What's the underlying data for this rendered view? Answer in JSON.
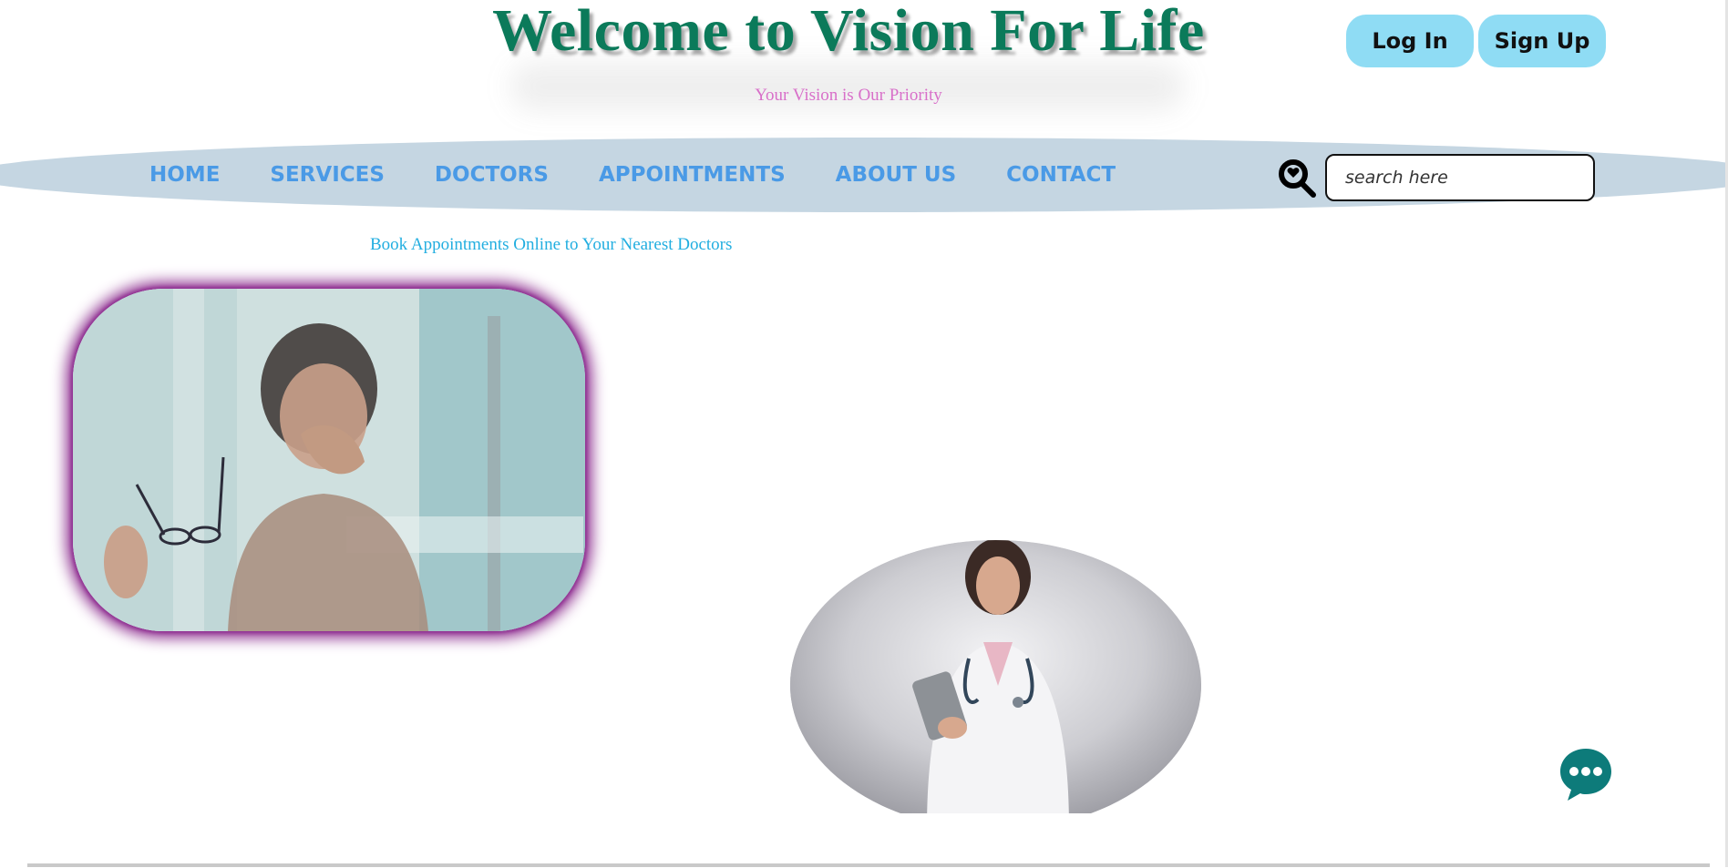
{
  "header": {
    "title": "Welcome to Vision For Life",
    "tagline": "Your Vision is Our Priority",
    "login_label": "Log In",
    "signup_label": "Sign Up"
  },
  "nav": {
    "items": [
      "HOME",
      "SERVICES",
      "DOCTORS",
      "APPOINTMENTS",
      "ABOUT US",
      "CONTACT"
    ],
    "search_placeholder": "search here",
    "search_icon": "search-magnifier-icon"
  },
  "main": {
    "promo_text": "Book Appointments Online to Your Nearest Doctors",
    "hero_image": "woman-rubbing-eyes-holding-glasses",
    "doctor_image": "female-doctor-with-stethoscope-and-tablet"
  },
  "chat": {
    "icon": "chat-bubble-icon"
  },
  "colors": {
    "title": "#0b7a5a",
    "tagline": "#d86fc9",
    "nav_bg": "#c5d6e2",
    "nav_link": "#4a9ae6",
    "auth_button": "#8fdcf4",
    "promo": "#22aee0",
    "hero_glow": "#8a2a8c",
    "chat": "#0d7b7a"
  }
}
